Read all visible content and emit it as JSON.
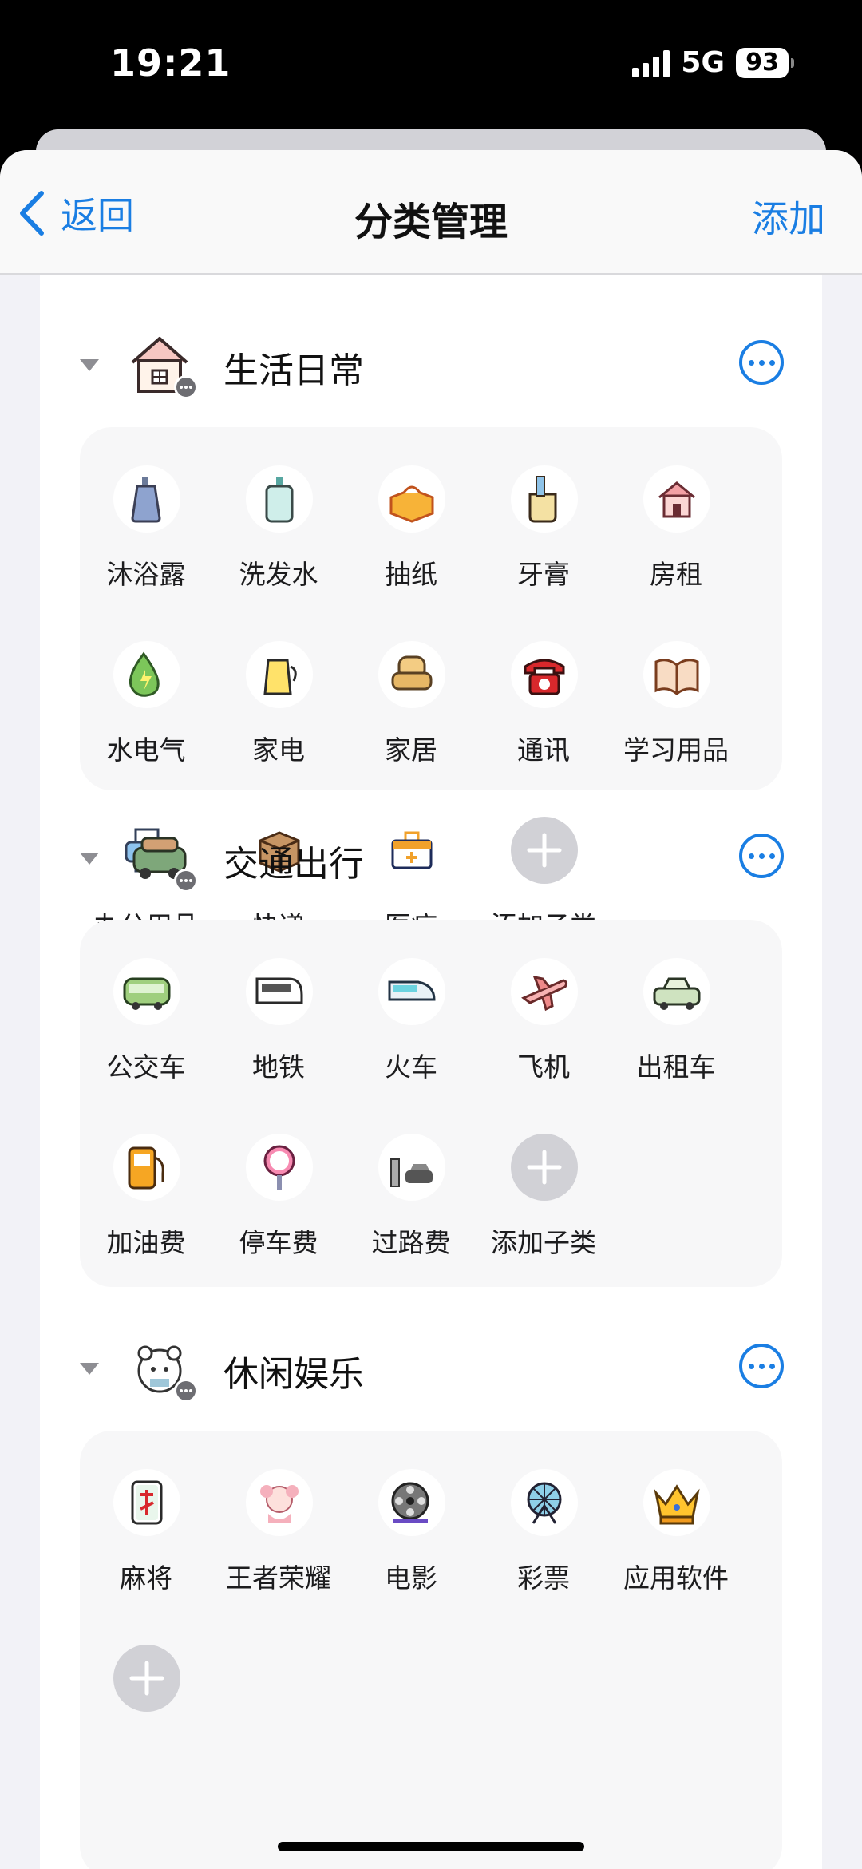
{
  "status": {
    "time": "19:21",
    "network": "5G",
    "battery": "93"
  },
  "nav": {
    "back_label": "返回",
    "title": "分类管理",
    "add_label": "添加"
  },
  "categories": [
    {
      "title": "生活日常",
      "icon": "house-icon",
      "items": [
        {
          "label": "沐浴露",
          "icon": "shower-gel-icon"
        },
        {
          "label": "洗发水",
          "icon": "shampoo-icon"
        },
        {
          "label": "抽纸",
          "icon": "tissue-box-icon"
        },
        {
          "label": "牙膏",
          "icon": "toothpaste-icon"
        },
        {
          "label": "房租",
          "icon": "house-icon"
        },
        {
          "label": "水电气",
          "icon": "utility-drop-icon"
        },
        {
          "label": "家电",
          "icon": "kettle-icon"
        },
        {
          "label": "家居",
          "icon": "armchair-icon"
        },
        {
          "label": "通讯",
          "icon": "telephone-icon"
        },
        {
          "label": "学习用品",
          "icon": "book-icon"
        },
        {
          "label": "办公用品",
          "icon": "printer-icon"
        },
        {
          "label": "快递",
          "icon": "parcel-box-icon"
        },
        {
          "label": "医疗",
          "icon": "medical-kit-icon"
        },
        {
          "label": "添加子类",
          "icon": "plus-icon"
        }
      ]
    },
    {
      "title": "交通出行",
      "icon": "car-icon",
      "items": [
        {
          "label": "公交车",
          "icon": "bus-icon"
        },
        {
          "label": "地铁",
          "icon": "subway-icon"
        },
        {
          "label": "火车",
          "icon": "train-icon"
        },
        {
          "label": "飞机",
          "icon": "airplane-icon"
        },
        {
          "label": "出租车",
          "icon": "taxi-icon"
        },
        {
          "label": "加油费",
          "icon": "fuel-pump-icon"
        },
        {
          "label": "停车费",
          "icon": "parking-sign-icon"
        },
        {
          "label": "过路费",
          "icon": "toll-gate-icon"
        },
        {
          "label": "添加子类",
          "icon": "plus-icon"
        }
      ]
    },
    {
      "title": "休闲娱乐",
      "icon": "bear-icon",
      "items": [
        {
          "label": "麻将",
          "icon": "mahjong-tile-icon"
        },
        {
          "label": "王者荣耀",
          "icon": "game-character-icon"
        },
        {
          "label": "电影",
          "icon": "film-reel-icon"
        },
        {
          "label": "彩票",
          "icon": "lottery-wheel-icon"
        },
        {
          "label": "应用软件",
          "icon": "crown-icon"
        }
      ]
    }
  ]
}
